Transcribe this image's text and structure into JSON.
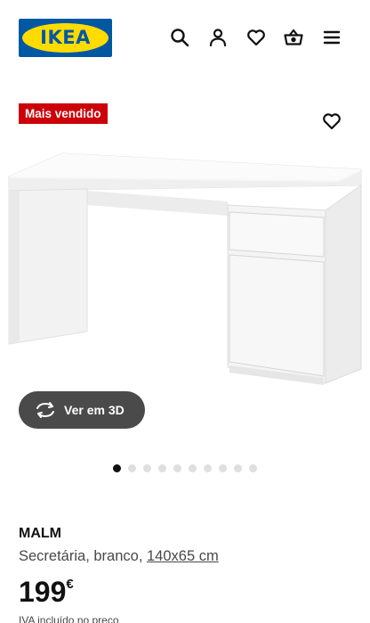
{
  "header": {
    "logo_text": "IKEA",
    "icons": [
      "search-icon",
      "user-icon",
      "heart-icon",
      "basket-icon",
      "menu-icon"
    ]
  },
  "product": {
    "badge": "Mais vendido",
    "image_alt_icon": "desk-image",
    "view_3d_label": "Ver em 3D",
    "gallery_total_images": 10,
    "gallery_active_index": 1,
    "name": "MALM",
    "description": "Secretária, branco, ",
    "size": "140x65 cm",
    "price": "199",
    "currency": "€",
    "vat_note": "IVA incluído no preço"
  },
  "colors": {
    "brand_blue": "#0058a3",
    "brand_yellow": "#ffdb00",
    "badge_red": "#cc0008",
    "button_3d_bg": "#4a4a4a"
  }
}
